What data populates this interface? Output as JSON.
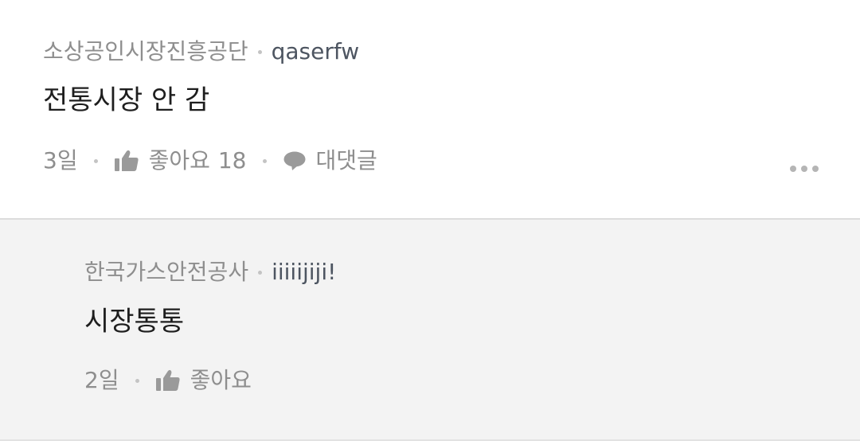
{
  "comments": [
    {
      "company": "소상공인시장진흥공단",
      "nickname": "qaserfw",
      "text": "전통시장 안 감",
      "time": "3일",
      "like_label": "좋아요",
      "like_count": "18",
      "reply_label": "대댓글"
    }
  ],
  "replies": [
    {
      "company": "한국가스안전공사",
      "nickname": "iiiiijiji!",
      "text": "시장통통",
      "time": "2일",
      "like_label": "좋아요"
    }
  ],
  "icons": {
    "like": "thumbs-up-icon",
    "reply": "speech-bubble-icon",
    "more": "more-horizontal-icon"
  },
  "colors": {
    "meta_gray": "#8e8e8e",
    "nickname": "#4d5561",
    "body_text": "#1e1e1e",
    "reply_background": "#f3f3f3"
  }
}
